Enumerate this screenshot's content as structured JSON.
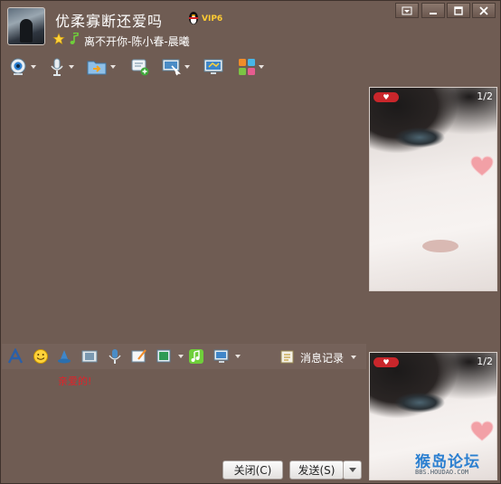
{
  "header": {
    "nickname": "优柔寡断还爱吗",
    "vip_label": "VIP6",
    "signature": "离不开你-陈小春-晨曦"
  },
  "window_controls": {
    "menu": "menu-icon",
    "minimize": "minimize-icon",
    "maximize": "maximize-icon",
    "close": "close-icon"
  },
  "toolbar_main": [
    {
      "name": "video-call",
      "icon": "webcam-icon",
      "has_dropdown": true
    },
    {
      "name": "voice-call",
      "icon": "microphone-icon",
      "has_dropdown": true
    },
    {
      "name": "send-file",
      "icon": "folder-icon",
      "has_dropdown": true
    },
    {
      "name": "create-discussion",
      "icon": "chat-add-icon",
      "has_dropdown": false
    },
    {
      "name": "remote-assist",
      "icon": "remote-desktop-icon",
      "has_dropdown": true
    },
    {
      "name": "share-screen",
      "icon": "monitor-icon",
      "has_dropdown": false
    },
    {
      "name": "apps",
      "icon": "apps-grid-icon",
      "has_dropdown": true
    }
  ],
  "photos": {
    "top_counter": "1/2",
    "bottom_counter": "1/2",
    "tag_text": "**",
    "tag_icon": "tag-badge-icon"
  },
  "toolbar_input": {
    "font_icon": "font-icon",
    "emoji_icon": "smiley-icon",
    "shake_icon": "shake-icon",
    "gallery_icon": "filmstrip-icon",
    "voice_icon": "voice-message-icon",
    "draw_icon": "doodle-icon",
    "screenshot_icon": "screenshot-icon",
    "music_icon": "music-icon",
    "screen_icon": "screen-share-icon",
    "history_label": "消息记录"
  },
  "input": {
    "text": "亲爱的!",
    "text_color": "#e0222a"
  },
  "buttons": {
    "close_label": "关闭(C)",
    "send_label": "发送(S)"
  },
  "watermark": {
    "title": "猴岛论坛",
    "url": "BBS.HOUDAO.COM"
  },
  "colors": {
    "background": "#6f5c53",
    "accent_red": "#c9262b"
  }
}
